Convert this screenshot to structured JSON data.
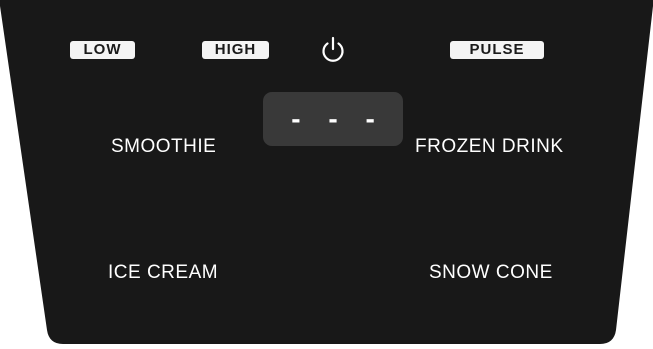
{
  "colors": {
    "panel": "#181818",
    "display_bg": "#393939",
    "pill_bg": "#f4f4f4",
    "text": "#ffffff"
  },
  "speed_buttons": {
    "low": "LOW",
    "high": "HIGH",
    "pulse": "PULSE"
  },
  "power": {
    "icon": "power-icon"
  },
  "display": {
    "readout": "- - -"
  },
  "programs": {
    "smoothie": "SMOOTHIE",
    "frozen_drink": "FROZEN DRINK",
    "ice_cream": "ICE CREAM",
    "snow_cone": "SNOW CONE"
  }
}
